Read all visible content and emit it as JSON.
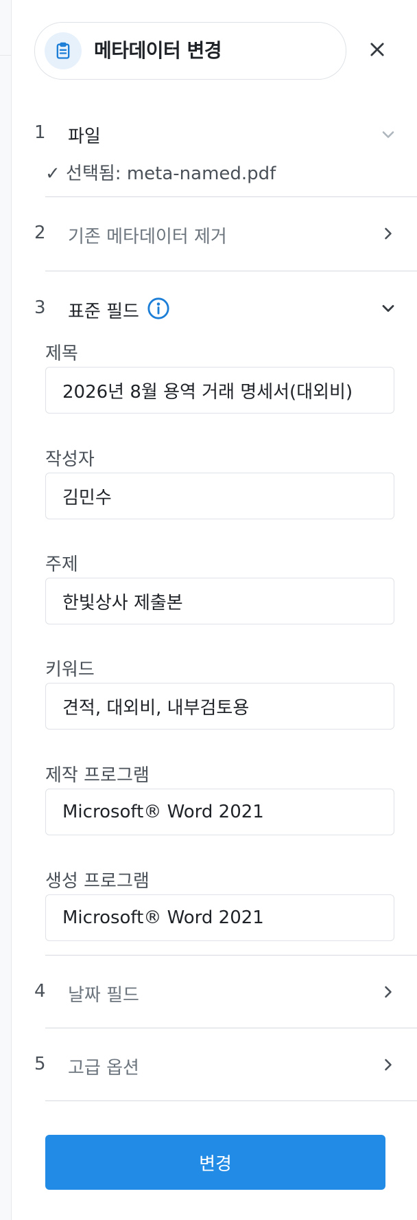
{
  "header": {
    "title": "메타데이터 변경",
    "title_icon": "clipboard-icon",
    "close_icon": "close-icon"
  },
  "steps": [
    {
      "num": "1",
      "title": "파일",
      "state": "expanded",
      "chevron": "chevron-down-icon"
    },
    {
      "num": "2",
      "title": "기존 메타데이터 제거",
      "state": "collapsed",
      "chevron": "chevron-right-icon"
    },
    {
      "num": "3",
      "title": "표준 필드",
      "state": "expanded",
      "chevron": "chevron-down-icon"
    },
    {
      "num": "4",
      "title": "날짜 필드",
      "state": "collapsed",
      "chevron": "chevron-right-icon"
    },
    {
      "num": "5",
      "title": "고급 옵션",
      "state": "collapsed",
      "chevron": "chevron-right-icon"
    }
  ],
  "file": {
    "status": "✓ 선택됨: meta-named.pdf"
  },
  "fields": [
    {
      "label": "제목",
      "value": "2026년 8월 용역 거래 명세서(대외비)"
    },
    {
      "label": "작성자",
      "value": "김민수"
    },
    {
      "label": "주제",
      "value": "한빛상사 제출본"
    },
    {
      "label": "키워드",
      "value": "견적, 대외비, 내부검토용"
    },
    {
      "label": "제작 프로그램",
      "value": "Microsoft® Word 2021"
    },
    {
      "label": "생성 프로그램",
      "value": "Microsoft® Word 2021"
    }
  ],
  "submit": {
    "label": "변경"
  },
  "colors": {
    "accent": "#228be6",
    "icon_bg": "#e7f1fc",
    "border": "#dee2e6"
  }
}
